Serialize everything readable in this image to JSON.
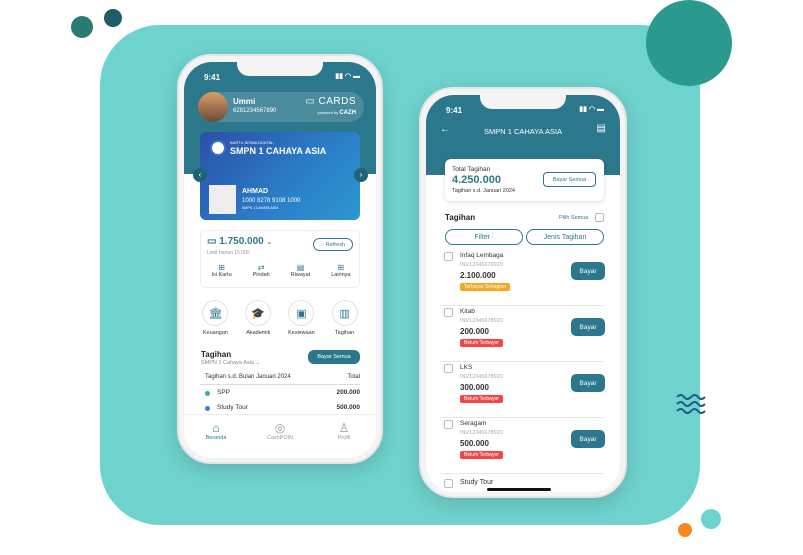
{
  "colors": {
    "teal_panel": "#6fd3cd",
    "primary": "#2b788c",
    "partial": "#f5a623",
    "unpaid": "#f04848"
  },
  "left_phone": {
    "time": "9:41",
    "user": {
      "name": "Ummi",
      "phone": "6281234567890"
    },
    "brand": {
      "name": "CARDS",
      "powered_by": "powered by",
      "company": "CAZH"
    },
    "card": {
      "subtitle": "KARTU SISWA DIGITAL",
      "school": "SMPN 1 CAHAYA ASIA",
      "student": "AHMAD",
      "number": "1000 8278 9108 1000",
      "school_small": "SMPN 1 CAHAYA ASIA"
    },
    "balance": {
      "amount": "1.750.000",
      "limit": "Limit harian 15.000",
      "refresh": "Refresh"
    },
    "actions": [
      {
        "label": "Isi Kartu",
        "icon": "plus-square-icon"
      },
      {
        "label": "Pindah",
        "icon": "transfer-icon"
      },
      {
        "label": "Riwayat",
        "icon": "history-icon"
      },
      {
        "label": "Lainnya",
        "icon": "grid-icon"
      }
    ],
    "menu": [
      {
        "label": "Keuangan",
        "icon": "bank-icon"
      },
      {
        "label": "Akademik",
        "icon": "graduation-icon"
      },
      {
        "label": "Kesiswaan",
        "icon": "student-icon"
      },
      {
        "label": "Tagihan",
        "icon": "bill-icon"
      }
    ],
    "tagihan": {
      "title": "Tagihan",
      "school": "SMPN 1 Cahaya Asia",
      "pay_all": "Bayar Semua",
      "period": "Tagihan s.d. Bulan Januari 2024",
      "total_label": "Total",
      "rows": [
        {
          "name": "SPP",
          "amount": "200.000",
          "color": "#2bb3a3"
        },
        {
          "name": "Study Tour",
          "amount": "500.000",
          "color": "#3b7de0"
        }
      ]
    },
    "nav": [
      {
        "label": "Beranda",
        "icon": "home-icon"
      },
      {
        "label": "CashPOIN",
        "icon": "fingerprint-icon"
      },
      {
        "label": "Profil",
        "icon": "user-icon"
      }
    ]
  },
  "right_phone": {
    "time": "9:41",
    "title": "SMPN 1 CAHAYA ASIA",
    "total": {
      "label": "Total Tagihan",
      "amount": "4.250.000",
      "period": "Tagihan s.d. Januari 2024",
      "pay_all": "Bayar Semua"
    },
    "section": "Tagihan",
    "select_all": "Pilih Semua",
    "filter": "Filter",
    "type": "Jenis Tagihan",
    "items": [
      {
        "name": "Infaq Lembaga",
        "invoice": "INV12345678920",
        "amount": "2.100.000",
        "status": "Terbayar Sebagian",
        "status_color": "#f5a623",
        "button": "Bayar"
      },
      {
        "name": "Kitab",
        "invoice": "INV12345678920",
        "amount": "200.000",
        "status": "Belum Terbayar",
        "status_color": "#f04848",
        "button": "Bayar"
      },
      {
        "name": "LKS",
        "invoice": "INV12345678920",
        "amount": "300.000",
        "status": "Belum Terbayar",
        "status_color": "#f04848",
        "button": "Bayar"
      },
      {
        "name": "Seragam",
        "invoice": "INV12345678920",
        "amount": "500.000",
        "status": "Belum Terbayar",
        "status_color": "#f04848",
        "button": "Bayar"
      }
    ],
    "partial_item": "Study Tour"
  }
}
